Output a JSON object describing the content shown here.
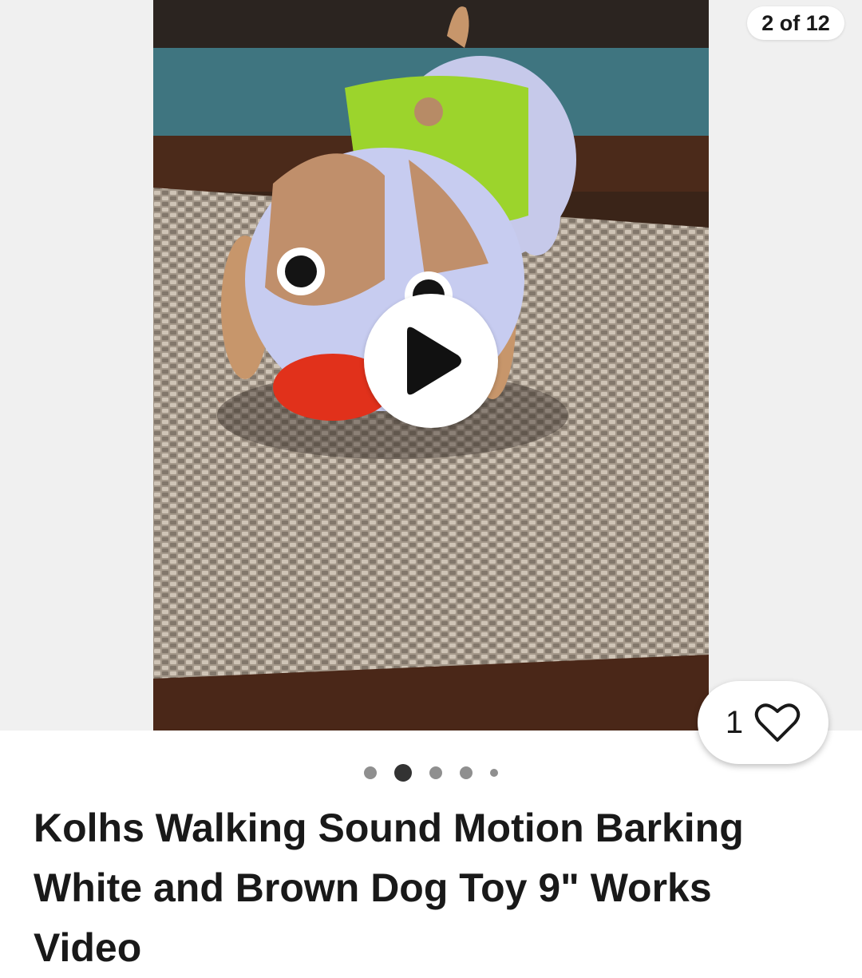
{
  "gallery": {
    "counter": "2 of 12",
    "current_index": 2,
    "total": 12,
    "media_type": "video",
    "media_alt": "White and brown toy dog with green body on woven placemat"
  },
  "watch": {
    "count": "1",
    "icon": "heart-outline-icon"
  },
  "pagination": {
    "dots": [
      {
        "state": "inactive"
      },
      {
        "state": "active"
      },
      {
        "state": "inactive"
      },
      {
        "state": "inactive"
      },
      {
        "state": "small"
      }
    ]
  },
  "listing": {
    "title": "Kolhs Walking Sound Motion Barking White and Brown Dog Toy 9\" Works Video"
  },
  "colors": {
    "text": "#191919",
    "dot_active": "#333333",
    "dot_inactive": "#8f8f8f",
    "gallery_bg": "#f0f0f0"
  }
}
